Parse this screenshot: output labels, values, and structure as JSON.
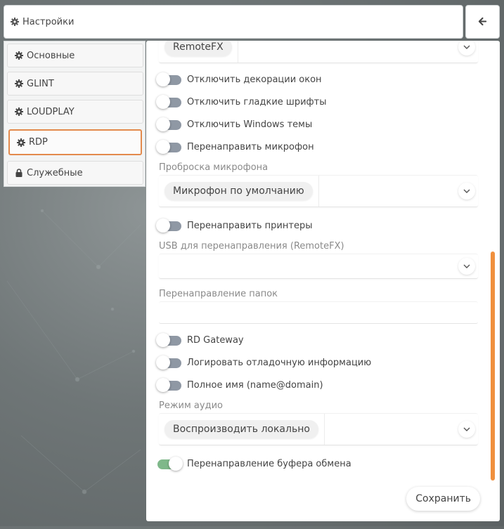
{
  "header": {
    "title": "Настройки"
  },
  "sidebar": {
    "items": [
      {
        "label": "Основные"
      },
      {
        "label": "GLINT"
      },
      {
        "label": "LOUDPLAY"
      },
      {
        "label": "RDP"
      },
      {
        "label": "Служебные"
      }
    ],
    "active": "RDP"
  },
  "form": {
    "top_select_value": "RemoteFX",
    "toggle_decorations": "Отключить декорации окон",
    "toggle_fonts": "Отключить гладкие шрифты",
    "toggle_themes": "Отключить Windows темы",
    "toggle_mic": "Перенаправить микрофон",
    "mic_label": "Проброска микрофона",
    "mic_value": "Микрофон по умолчанию",
    "toggle_printers": "Перенаправить принтеры",
    "usb_label": "USB для перенаправления (RemoteFX)",
    "folders_label": "Перенаправление папок",
    "toggle_gateway": "RD Gateway",
    "toggle_debug": "Логировать отладочную информацию",
    "toggle_fullname": "Полное имя (name@domain)",
    "audio_label": "Режим аудио",
    "audio_value": "Воспроизводить локально",
    "toggle_clipboard": "Перенаправление буфера обмена",
    "clipboard_on": true,
    "save_label": "Сохранить"
  },
  "colors": {
    "accent": "#f0903e",
    "active_border": "#e38a4c",
    "toggle_off": "#8f98a4",
    "toggle_on": "#7fb88a"
  }
}
